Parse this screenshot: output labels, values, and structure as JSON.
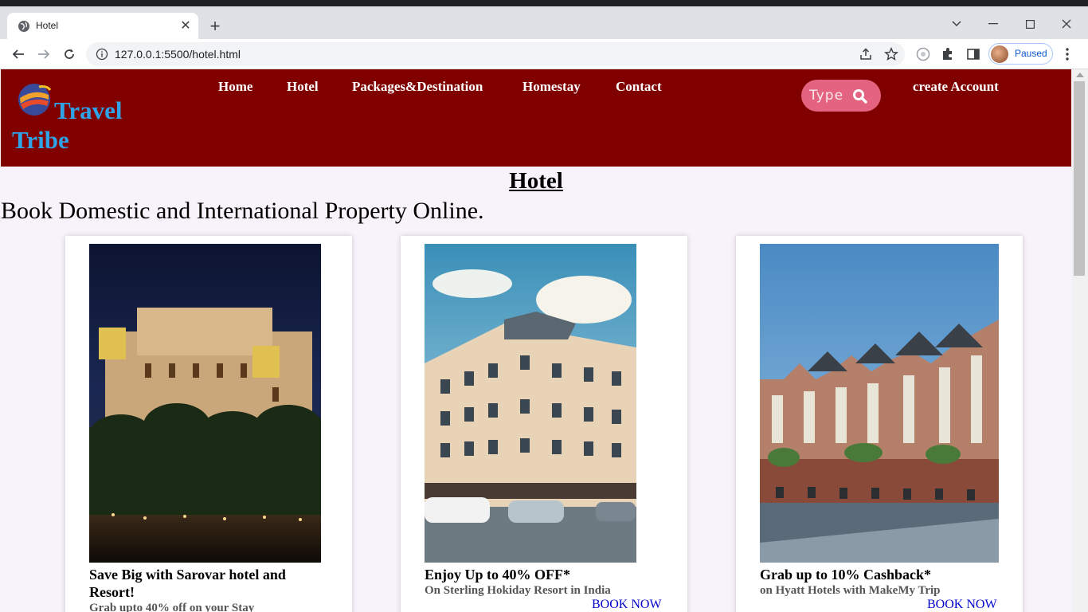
{
  "browser": {
    "tab_title": "Hotel",
    "url": "127.0.0.1:5500/hotel.html",
    "profile_label": "Paused",
    "icons": [
      "globe-icon",
      "close-icon",
      "plus-icon",
      "chevron-down-icon",
      "minimize-icon",
      "maximize-icon",
      "window-close-icon",
      "back-icon",
      "forward-icon",
      "reload-icon",
      "info-icon",
      "share-icon",
      "star-icon",
      "extension-icon",
      "puzzle-icon",
      "side-panel-icon",
      "menu-icon"
    ]
  },
  "site": {
    "brand": "Travel Tribe",
    "nav": [
      "Home",
      "Hotel",
      "Packages&Destination",
      "Homestay",
      "Contact"
    ],
    "search_placeholder": "Type",
    "create_account": "create Account",
    "colors": {
      "header_bg": "#800000",
      "brand_text": "#2fa3e8",
      "search_bg": "#e36380",
      "page_bg": "#f8f2fa"
    }
  },
  "main": {
    "title": "Hotel",
    "subtitle": "Book Domestic and International Property Online."
  },
  "cards": [
    {
      "title": "Save Big with Sarovar hotel and Resort!",
      "subtitle": "Grab upto 40% off on your Stay",
      "button": ""
    },
    {
      "title": "Enjoy Up to 40% OFF*",
      "subtitle": "On Sterling Hokiday Resort in India",
      "button": "BOOK NOW"
    },
    {
      "title": "Grab up to 10% Cashback*",
      "subtitle": "on Hyatt Hotels with MakeMy Trip",
      "button": "BOOK NOW"
    }
  ]
}
